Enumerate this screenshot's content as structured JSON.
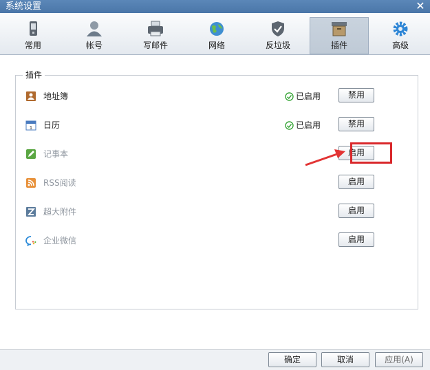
{
  "window": {
    "title": "系统设置",
    "close_label": "✕"
  },
  "tabs": [
    {
      "label": "常用",
      "icon": "phone-icon",
      "active": false
    },
    {
      "label": "帐号",
      "icon": "user-icon",
      "active": false
    },
    {
      "label": "写邮件",
      "icon": "printer-icon",
      "active": false
    },
    {
      "label": "网络",
      "icon": "globe-icon",
      "active": false
    },
    {
      "label": "反垃圾",
      "icon": "shield-icon",
      "active": false
    },
    {
      "label": "插件",
      "icon": "box-icon",
      "active": true
    },
    {
      "label": "高级",
      "icon": "gear-icon",
      "active": false
    }
  ],
  "plugins": {
    "group_title": "插件",
    "items": [
      {
        "name": "地址簿",
        "icon": "address-book-icon",
        "status": "已启用",
        "button": "禁用",
        "enabled": true
      },
      {
        "name": "日历",
        "icon": "calendar-icon",
        "status": "已启用",
        "button": "禁用",
        "enabled": true
      },
      {
        "name": "记事本",
        "icon": "notepad-icon",
        "status": "",
        "button": "启用",
        "enabled": false
      },
      {
        "name": "RSS阅读",
        "icon": "rss-icon",
        "status": "",
        "button": "启用",
        "enabled": false
      },
      {
        "name": "超大附件",
        "icon": "attachment-icon",
        "status": "",
        "button": "启用",
        "enabled": false
      },
      {
        "name": "企业微信",
        "icon": "wechat-work-icon",
        "status": "",
        "button": "启用",
        "enabled": false
      }
    ]
  },
  "footer": {
    "ok_label": "确定",
    "cancel_label": "取消",
    "apply_label": "应用(A)"
  },
  "colors": {
    "titlebar": "#4a76a8",
    "highlight": "#d9272a",
    "check": "#3aa63a"
  }
}
